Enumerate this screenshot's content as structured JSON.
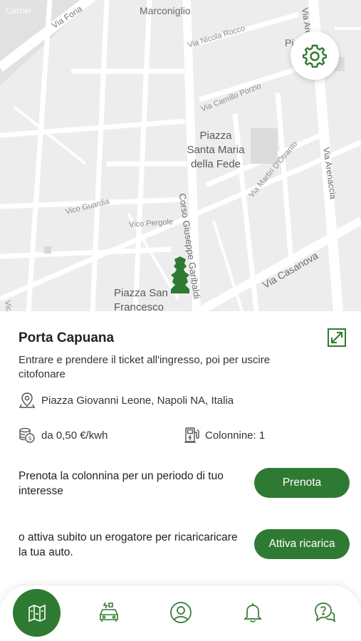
{
  "status": {
    "carrier": "Carrier"
  },
  "map": {
    "labels": {
      "via_foria": "Via Foria",
      "marconiglio": "Marconiglio",
      "via_nicola_rocco": "Via Nicola Rocco",
      "piazza_top_right": "Pi          gi",
      "via_camillo_porzio": "Via Camillo Porzio",
      "piazza_santa_maria": "Piazza\nSanta Maria\ndella Fede",
      "via_martiri": "Via Martiri D'Otranto",
      "via_arenaccia": "Via Arenaccia",
      "via_arenaccia_top": "Via Arenaccia",
      "corso_garibaldi": "Corso Giuseppe Garibaldi",
      "vico_guardia": "Vico Guardia",
      "vico_pergole": "Vico Pergole",
      "via_casanova": "Via Casanova",
      "piazza_san_francesco": "Piazza San\nFrancesco",
      "vico_left": "Vico"
    },
    "settings_icon": "gear-icon",
    "marker_icon": "charging-station-marker-icon"
  },
  "station": {
    "name": "Porta Capuana",
    "description": "Entrare e prendere il ticket all'ingresso, poi per uscire citofonare",
    "address": "Piazza Giovanni Leone, Napoli NA, Italia",
    "price": "da 0,50 €/kwh",
    "stations_count": "Colonnine: 1"
  },
  "actions": {
    "book_prompt": "Prenota la colonnina per un periodo di tuo interesse",
    "book_label": "Prenota",
    "charge_prompt": "o attiva subito un erogatore per ricaricaricare la tua auto.",
    "charge_label": "Attiva ricarica"
  },
  "nav": {
    "items": [
      "map-icon",
      "car-charging-icon",
      "profile-icon",
      "bell-icon",
      "help-chat-icon"
    ],
    "active": "map-icon"
  },
  "colors": {
    "accent": "#2f7a32",
    "map_bg": "#ededed",
    "road": "#ffffff"
  }
}
